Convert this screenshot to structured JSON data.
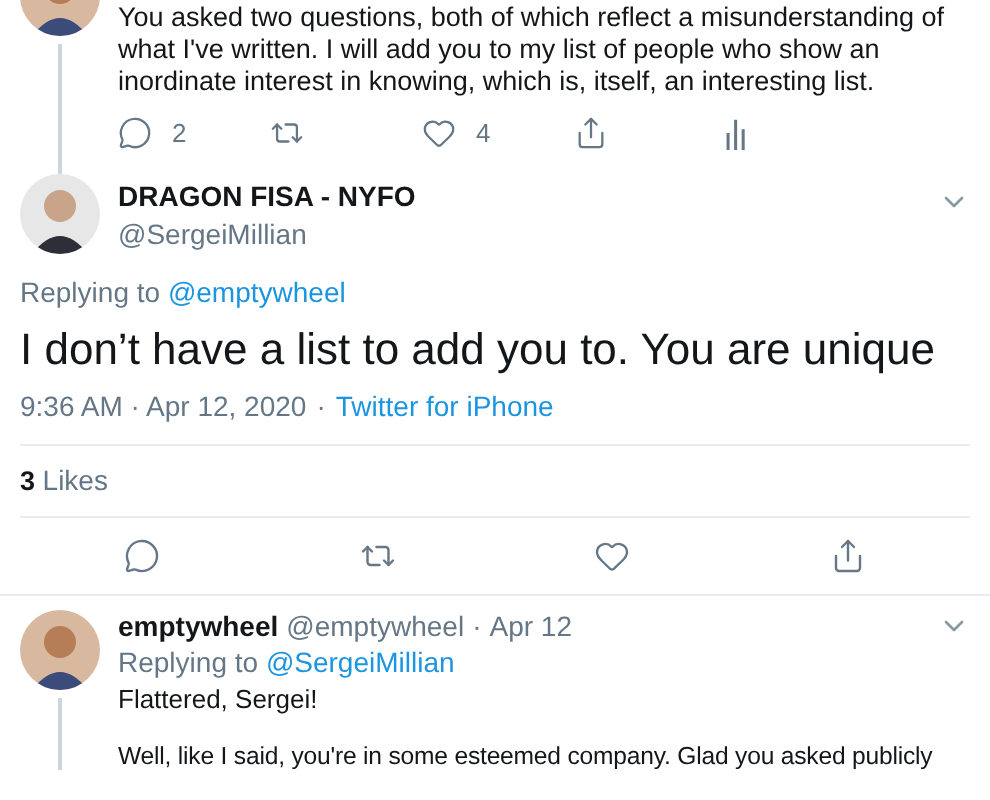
{
  "previous_tweet": {
    "text": "You asked two questions, both of which reflect a misunderstanding of what I've written. I will add you to my list of people who show an inordinate interest in knowing, which is, itself, an interesting list.",
    "actions": [
      {
        "kind": "reply",
        "count": "2"
      },
      {
        "kind": "retweet"
      },
      {
        "kind": "like",
        "count": "4"
      },
      {
        "kind": "share"
      },
      {
        "kind": "analytics"
      }
    ]
  },
  "main_tweet": {
    "name": "DRAGON FISA - NYFO",
    "handle": "@SergeiMillian",
    "replying_label": "Replying to",
    "replying_to": "@emptywheel",
    "text": "I don’t have a list to add you to. You are unique",
    "time": "9:36 AM · Apr 12, 2020",
    "separator": "·",
    "source": "Twitter for iPhone",
    "likes_count": "3",
    "likes_label": "Likes",
    "actions": [
      {
        "kind": "reply"
      },
      {
        "kind": "retweet"
      },
      {
        "kind": "like"
      },
      {
        "kind": "share"
      }
    ]
  },
  "reply_tweet": {
    "name": "emptywheel",
    "handle": "@emptywheel",
    "separator": "·",
    "date": "Apr 12",
    "replying_label": "Replying to",
    "replying_to": "@SergeiMillian",
    "paragraphs": [
      "Flattered, Sergei!",
      "Well, like I said, you're in some esteemed company. Glad you asked publicly"
    ]
  }
}
